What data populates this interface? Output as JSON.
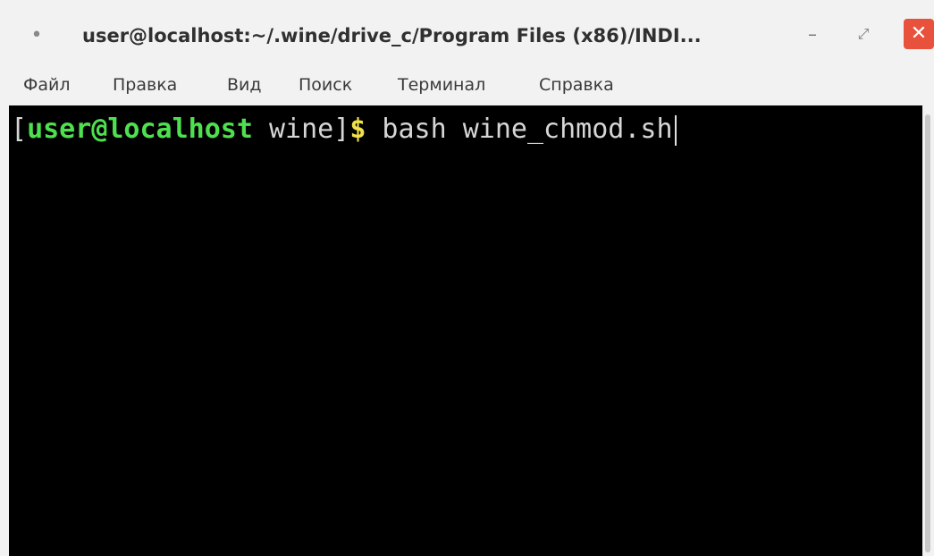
{
  "window": {
    "title": "user@localhost:~/.wine/drive_c/Program Files (x86)/INDI...",
    "menu_glyph": "•",
    "minimize_glyph": "–",
    "maximize_glyph": "⤢",
    "close_glyph": "✕",
    "close_color": "#e8513b"
  },
  "menu": {
    "items": [
      {
        "label": "Файл"
      },
      {
        "label": "Правка"
      },
      {
        "label": "Вид"
      },
      {
        "label": "Поиск"
      },
      {
        "label": "Терминал"
      },
      {
        "label": "Справка"
      }
    ]
  },
  "terminal": {
    "background": "#000000",
    "prompt_open": "[",
    "prompt_userhost": "user@localhost",
    "prompt_dir": " wine",
    "prompt_close": "]",
    "prompt_symbol": "$",
    "command": " bash wine_chmod.sh",
    "prompt_color": "#4ee04e",
    "symbol_color": "#f1e24a"
  }
}
